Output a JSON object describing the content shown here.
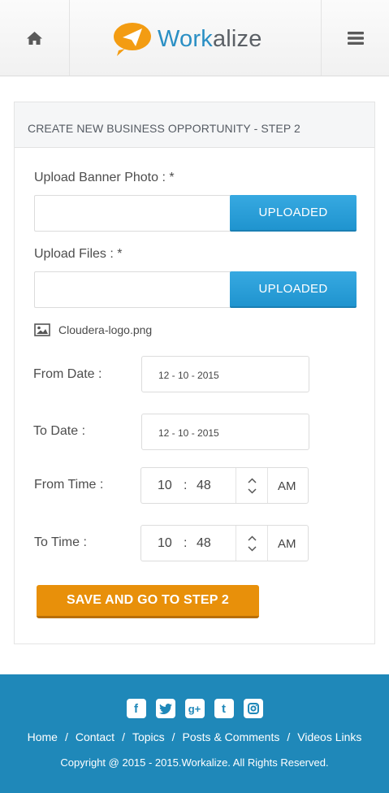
{
  "header": {
    "brand_prefix": "Work",
    "brand_suffix": "alize",
    "home_icon": "home-icon",
    "menu_icon": "hamburger-menu-icon",
    "accent": "#2a8fc4",
    "logo_bubble_color": "#f39c12"
  },
  "form": {
    "title": "CREATE NEW BUSINESS OPPORTUNITY - STEP 2",
    "banner_label": "Upload Banner Photo : *",
    "banner_value": "",
    "banner_button": "UPLOADED",
    "files_label": "Upload Files : *",
    "files_value": "",
    "files_button": "UPLOADED",
    "attached_file": "Cloudera-logo.png",
    "from_date_label": "From Date :",
    "from_date_value": "12 - 10 - 2015",
    "to_date_label": "To Date :",
    "to_date_value": "12 - 10 - 2015",
    "from_time_label": "From Time :",
    "from_time": {
      "hour": "10",
      "sep": ":",
      "minute": "48",
      "ampm": "AM"
    },
    "to_time_label": "To Time :",
    "to_time": {
      "hour": "10",
      "sep": ":",
      "minute": "48",
      "ampm": "AM"
    },
    "save_button": "SAVE AND GO TO STEP 2",
    "button_color": "#e8900a",
    "upload_color": "#2a9fd8"
  },
  "footer": {
    "social_icons": [
      "facebook-icon",
      "twitter-icon",
      "google-plus-icon",
      "tumblr-icon",
      "instagram-icon"
    ],
    "links": [
      "Home",
      "Contact",
      "Topics",
      "Posts & Comments",
      "Videos Links"
    ],
    "separator": "/",
    "copyright": "Copyright @ 2015 - 2015.Workalize. All Rights Reserved.",
    "bg": "#1f88b9"
  }
}
